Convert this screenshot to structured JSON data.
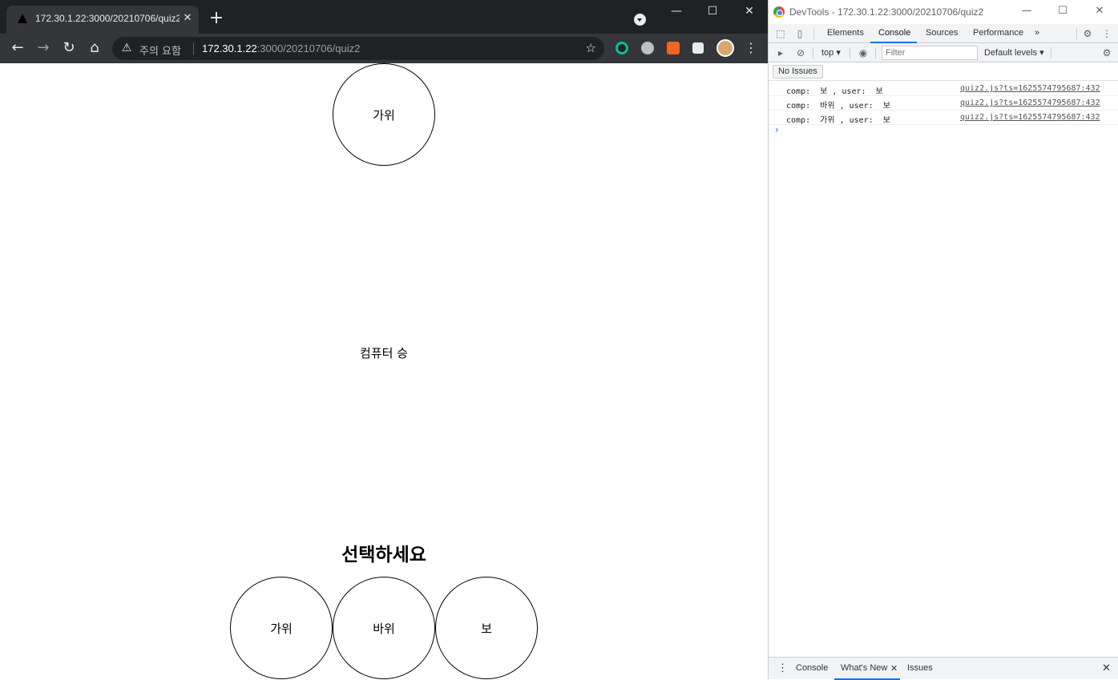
{
  "browser": {
    "tab_title": "172.30.1.22:3000/20210706/quiz2",
    "tab_close": "✕",
    "new_tab": "+",
    "address": {
      "warning_text": "주의 요함",
      "host": "172.30.1.22",
      "path": ":3000/20210706/quiz2"
    },
    "window_controls": {
      "minimize": "—",
      "maximize": "☐",
      "close": "✕"
    }
  },
  "page": {
    "computer_choice": "가위",
    "result": "컴퓨터 승",
    "prompt": "선택하세요",
    "options": [
      "가위",
      "바위",
      "보"
    ]
  },
  "devtools": {
    "window_title": "DevTools - 172.30.1.22:3000/20210706/quiz2",
    "tabs": [
      "Elements",
      "Console",
      "Sources",
      "Performance"
    ],
    "more_tabs": "»",
    "context": "top",
    "filter_placeholder": "Filter",
    "levels": "Default levels",
    "no_issues": "No Issues",
    "logs": [
      {
        "message": "comp:  보 , user:  보",
        "source": "quiz2.js?ts=1625574795687:432"
      },
      {
        "message": "comp:  바위 , user:  보",
        "source": "quiz2.js?ts=1625574795687:432"
      },
      {
        "message": "comp:  가위 , user:  보",
        "source": "quiz2.js?ts=1625574795687:432"
      }
    ],
    "drawer_tabs": [
      "Console",
      "What's New",
      "Issues"
    ],
    "drawer_tab_close": "✕",
    "drawer_close": "✕"
  }
}
